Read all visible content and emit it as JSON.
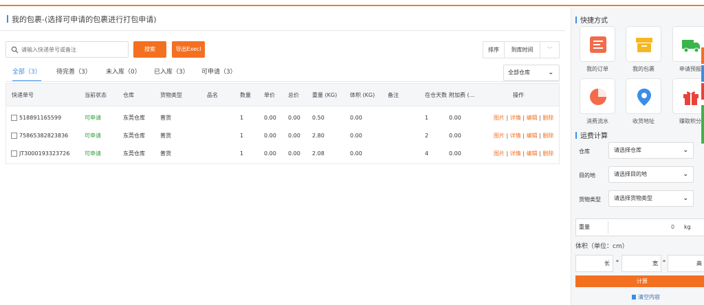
{
  "header": {
    "title": "我的包裹-(选择可申请的包裹进行打包申请)"
  },
  "toolbar": {
    "search_placeholder": "请输入快递单号或备注",
    "search_button": "搜索",
    "export_button": "导出Execl",
    "sort_label": "排序",
    "sort_value": "到库时间",
    "sort_arrow": "﹀"
  },
  "tabs": [
    {
      "label": "全部（3）"
    },
    {
      "label": "待完善（3）"
    },
    {
      "label": "未入库（0）"
    },
    {
      "label": "已入库（3）"
    },
    {
      "label": "可申请（3）"
    }
  ],
  "warehouse_filter": "全部仓库",
  "table": {
    "columns": [
      "快递单号",
      "当前状态",
      "仓库",
      "货物类型",
      "品名",
      "数量",
      "单价",
      "总价",
      "重量 (KG)",
      "体积 (KG)",
      "备注",
      "在仓天数",
      "附加费 (...",
      "操作"
    ],
    "rows": [
      {
        "tracking": "518891165599",
        "status": "可申请",
        "warehouse": "东莞仓库",
        "type": "普货",
        "name": "",
        "qty": "1",
        "unit_price": "0.00",
        "total": "0.00",
        "weight": "0.50",
        "volume": "0.00",
        "note": "",
        "days": "1",
        "surcharge": "0.00"
      },
      {
        "tracking": "75865382823836",
        "status": "可申请",
        "warehouse": "东莞仓库",
        "type": "普货",
        "name": "",
        "qty": "1",
        "unit_price": "0.00",
        "total": "0.00",
        "weight": "2.80",
        "volume": "0.00",
        "note": "",
        "days": "2",
        "surcharge": "0.00"
      },
      {
        "tracking": "JT3000193323726",
        "status": "可申请",
        "warehouse": "东莞仓库",
        "type": "普货",
        "name": "",
        "qty": "1",
        "unit_price": "0.00",
        "total": "0.00",
        "weight": "2.08",
        "volume": "0.00",
        "note": "",
        "days": "4",
        "surcharge": "0.00"
      }
    ],
    "ops": {
      "image": "图片",
      "detail": "详情",
      "edit": "编辑",
      "delete": "删除",
      "sep": "|"
    }
  },
  "quick": {
    "title": "快捷方式",
    "items": [
      {
        "label": "我的订单",
        "icon": "order-icon",
        "color": "#f36b4a"
      },
      {
        "label": "我的包裹",
        "icon": "package-icon",
        "color": "#f5b820"
      },
      {
        "label": "申请预报",
        "icon": "truck-icon",
        "color": "#3ab54a"
      },
      {
        "label": "消费流水",
        "icon": "pie-chart-icon",
        "color": "#f36b4a"
      },
      {
        "label": "收货地址",
        "icon": "location-pin-icon",
        "color": "#3a8ee6"
      },
      {
        "label": "赚取积分",
        "icon": "gift-icon",
        "color": "#e8423a"
      }
    ]
  },
  "calc": {
    "title": "运费计算",
    "warehouse_label": "仓库",
    "warehouse_value": "请选择仓库",
    "dest_label": "目的地",
    "dest_value": "请选择目的地",
    "type_label": "货物类型",
    "type_value": "请选择货物类型",
    "weight_label": "重量",
    "weight_value": "0",
    "weight_unit": "kg",
    "volume_title": "体积（单位：cm）",
    "length": "长",
    "width": "宽",
    "height": "高",
    "times": "*",
    "calc_button": "计算",
    "clear_link": "清空内容"
  },
  "colors": {
    "accent": "#f37021",
    "primary": "#3a8ee6",
    "status_green": "#2e9e3a"
  }
}
